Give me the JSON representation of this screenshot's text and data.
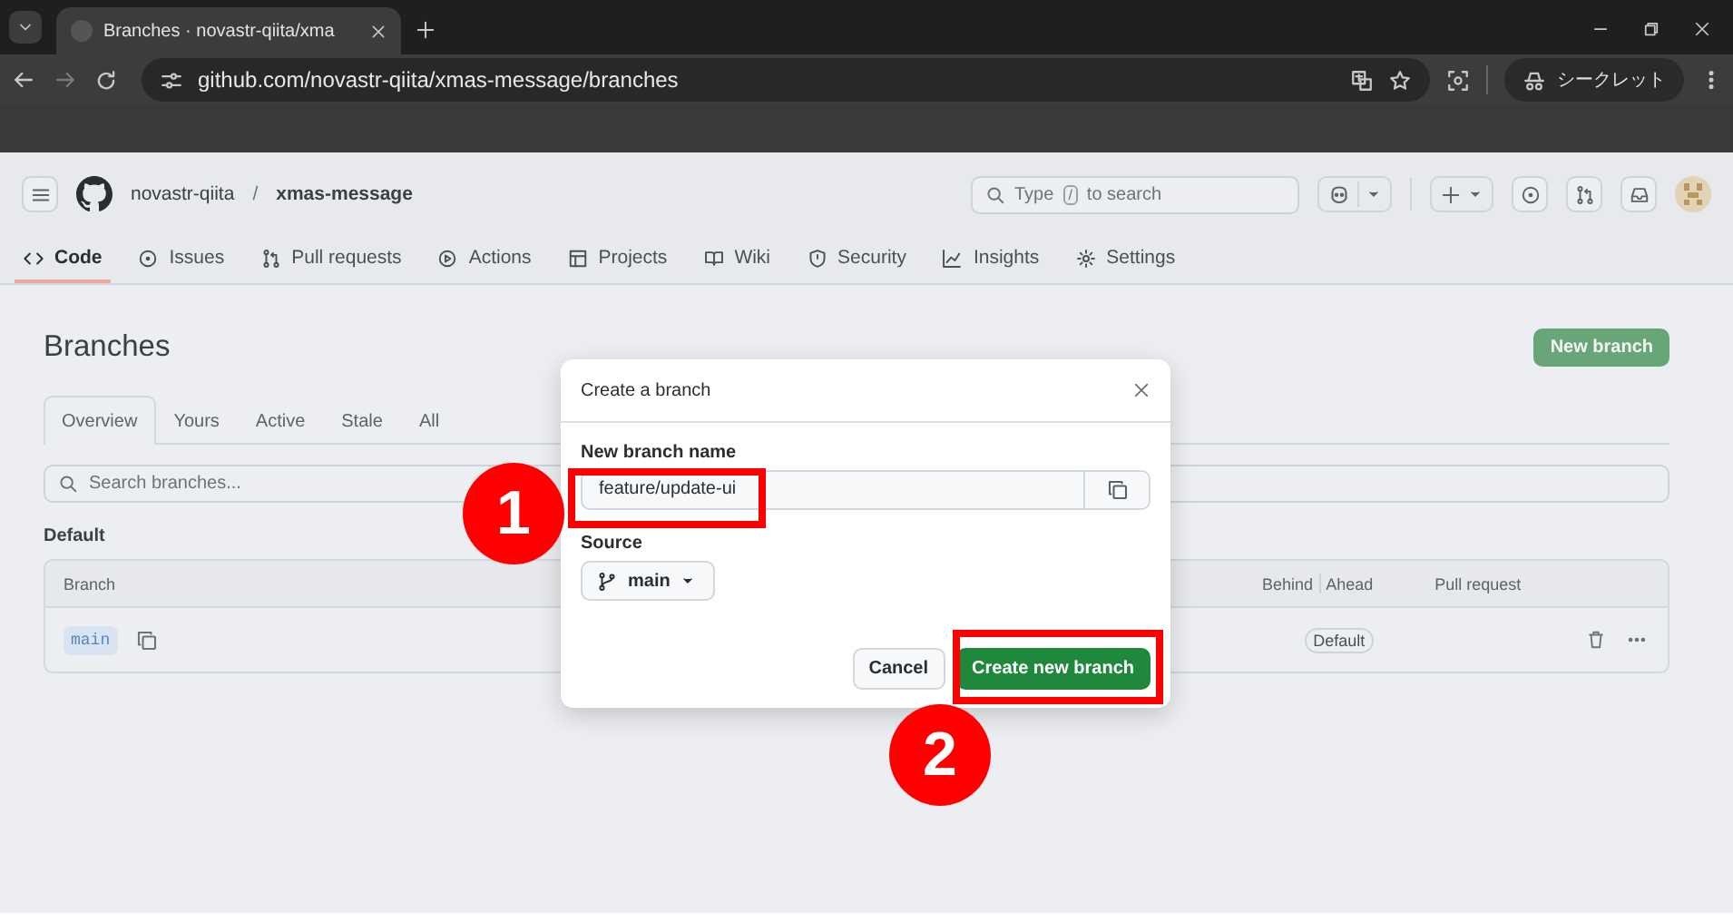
{
  "browser": {
    "tab_title": "Branches · novastr-qiita/xma",
    "url": "github.com/novastr-qiita/xmas-message/branches",
    "incognito_label": "シークレット"
  },
  "header": {
    "owner": "novastr-qiita",
    "separator": "/",
    "repo": "xmas-message",
    "search": {
      "prefix": "Type",
      "key": "/",
      "suffix": "to search"
    }
  },
  "nav": [
    {
      "kind": "code",
      "label": "Code",
      "selected": true
    },
    {
      "kind": "issues",
      "label": "Issues",
      "selected": false
    },
    {
      "kind": "pulls",
      "label": "Pull requests",
      "selected": false
    },
    {
      "kind": "actions",
      "label": "Actions",
      "selected": false
    },
    {
      "kind": "projects",
      "label": "Projects",
      "selected": false
    },
    {
      "kind": "wiki",
      "label": "Wiki",
      "selected": false
    },
    {
      "kind": "security",
      "label": "Security",
      "selected": false
    },
    {
      "kind": "insights",
      "label": "Insights",
      "selected": false
    },
    {
      "kind": "settings",
      "label": "Settings",
      "selected": false
    }
  ],
  "page": {
    "title": "Branches",
    "new_branch_button": "New branch",
    "tabs": [
      {
        "label": "Overview",
        "selected": true
      },
      {
        "label": "Yours",
        "selected": false
      },
      {
        "label": "Active",
        "selected": false
      },
      {
        "label": "Stale",
        "selected": false
      },
      {
        "label": "All",
        "selected": false
      }
    ],
    "search_placeholder": "Search branches...",
    "section": "Default",
    "columns": {
      "branch": "Branch",
      "behind": "Behind",
      "ahead": "Ahead",
      "pull_request": "Pull request"
    },
    "rows": [
      {
        "name": "main",
        "badge": "Default"
      }
    ]
  },
  "dialog": {
    "title": "Create a branch",
    "name_label": "New branch name",
    "name_value": "feature/update-ui",
    "source_label": "Source",
    "source_value": "main",
    "cancel": "Cancel",
    "confirm": "Create new branch"
  },
  "callouts": [
    {
      "number": "1"
    },
    {
      "number": "2"
    }
  ]
}
